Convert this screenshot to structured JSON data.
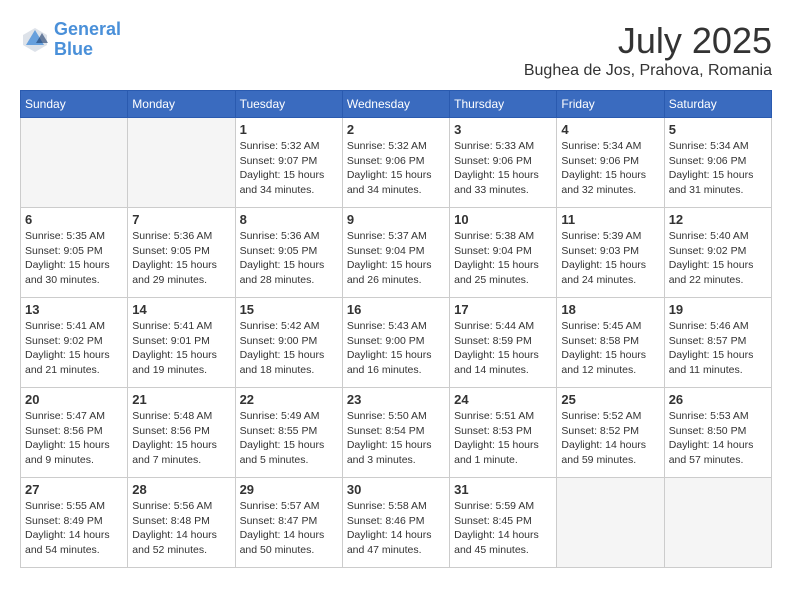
{
  "header": {
    "logo_line1": "General",
    "logo_line2": "Blue",
    "month_year": "July 2025",
    "location": "Bughea de Jos, Prahova, Romania"
  },
  "weekdays": [
    "Sunday",
    "Monday",
    "Tuesday",
    "Wednesday",
    "Thursday",
    "Friday",
    "Saturday"
  ],
  "weeks": [
    [
      {
        "day": "",
        "info": ""
      },
      {
        "day": "",
        "info": ""
      },
      {
        "day": "1",
        "info": "Sunrise: 5:32 AM\nSunset: 9:07 PM\nDaylight: 15 hours and 34 minutes."
      },
      {
        "day": "2",
        "info": "Sunrise: 5:32 AM\nSunset: 9:06 PM\nDaylight: 15 hours and 34 minutes."
      },
      {
        "day": "3",
        "info": "Sunrise: 5:33 AM\nSunset: 9:06 PM\nDaylight: 15 hours and 33 minutes."
      },
      {
        "day": "4",
        "info": "Sunrise: 5:34 AM\nSunset: 9:06 PM\nDaylight: 15 hours and 32 minutes."
      },
      {
        "day": "5",
        "info": "Sunrise: 5:34 AM\nSunset: 9:06 PM\nDaylight: 15 hours and 31 minutes."
      }
    ],
    [
      {
        "day": "6",
        "info": "Sunrise: 5:35 AM\nSunset: 9:05 PM\nDaylight: 15 hours and 30 minutes."
      },
      {
        "day": "7",
        "info": "Sunrise: 5:36 AM\nSunset: 9:05 PM\nDaylight: 15 hours and 29 minutes."
      },
      {
        "day": "8",
        "info": "Sunrise: 5:36 AM\nSunset: 9:05 PM\nDaylight: 15 hours and 28 minutes."
      },
      {
        "day": "9",
        "info": "Sunrise: 5:37 AM\nSunset: 9:04 PM\nDaylight: 15 hours and 26 minutes."
      },
      {
        "day": "10",
        "info": "Sunrise: 5:38 AM\nSunset: 9:04 PM\nDaylight: 15 hours and 25 minutes."
      },
      {
        "day": "11",
        "info": "Sunrise: 5:39 AM\nSunset: 9:03 PM\nDaylight: 15 hours and 24 minutes."
      },
      {
        "day": "12",
        "info": "Sunrise: 5:40 AM\nSunset: 9:02 PM\nDaylight: 15 hours and 22 minutes."
      }
    ],
    [
      {
        "day": "13",
        "info": "Sunrise: 5:41 AM\nSunset: 9:02 PM\nDaylight: 15 hours and 21 minutes."
      },
      {
        "day": "14",
        "info": "Sunrise: 5:41 AM\nSunset: 9:01 PM\nDaylight: 15 hours and 19 minutes."
      },
      {
        "day": "15",
        "info": "Sunrise: 5:42 AM\nSunset: 9:00 PM\nDaylight: 15 hours and 18 minutes."
      },
      {
        "day": "16",
        "info": "Sunrise: 5:43 AM\nSunset: 9:00 PM\nDaylight: 15 hours and 16 minutes."
      },
      {
        "day": "17",
        "info": "Sunrise: 5:44 AM\nSunset: 8:59 PM\nDaylight: 15 hours and 14 minutes."
      },
      {
        "day": "18",
        "info": "Sunrise: 5:45 AM\nSunset: 8:58 PM\nDaylight: 15 hours and 12 minutes."
      },
      {
        "day": "19",
        "info": "Sunrise: 5:46 AM\nSunset: 8:57 PM\nDaylight: 15 hours and 11 minutes."
      }
    ],
    [
      {
        "day": "20",
        "info": "Sunrise: 5:47 AM\nSunset: 8:56 PM\nDaylight: 15 hours and 9 minutes."
      },
      {
        "day": "21",
        "info": "Sunrise: 5:48 AM\nSunset: 8:56 PM\nDaylight: 15 hours and 7 minutes."
      },
      {
        "day": "22",
        "info": "Sunrise: 5:49 AM\nSunset: 8:55 PM\nDaylight: 15 hours and 5 minutes."
      },
      {
        "day": "23",
        "info": "Sunrise: 5:50 AM\nSunset: 8:54 PM\nDaylight: 15 hours and 3 minutes."
      },
      {
        "day": "24",
        "info": "Sunrise: 5:51 AM\nSunset: 8:53 PM\nDaylight: 15 hours and 1 minute."
      },
      {
        "day": "25",
        "info": "Sunrise: 5:52 AM\nSunset: 8:52 PM\nDaylight: 14 hours and 59 minutes."
      },
      {
        "day": "26",
        "info": "Sunrise: 5:53 AM\nSunset: 8:50 PM\nDaylight: 14 hours and 57 minutes."
      }
    ],
    [
      {
        "day": "27",
        "info": "Sunrise: 5:55 AM\nSunset: 8:49 PM\nDaylight: 14 hours and 54 minutes."
      },
      {
        "day": "28",
        "info": "Sunrise: 5:56 AM\nSunset: 8:48 PM\nDaylight: 14 hours and 52 minutes."
      },
      {
        "day": "29",
        "info": "Sunrise: 5:57 AM\nSunset: 8:47 PM\nDaylight: 14 hours and 50 minutes."
      },
      {
        "day": "30",
        "info": "Sunrise: 5:58 AM\nSunset: 8:46 PM\nDaylight: 14 hours and 47 minutes."
      },
      {
        "day": "31",
        "info": "Sunrise: 5:59 AM\nSunset: 8:45 PM\nDaylight: 14 hours and 45 minutes."
      },
      {
        "day": "",
        "info": ""
      },
      {
        "day": "",
        "info": ""
      }
    ]
  ]
}
